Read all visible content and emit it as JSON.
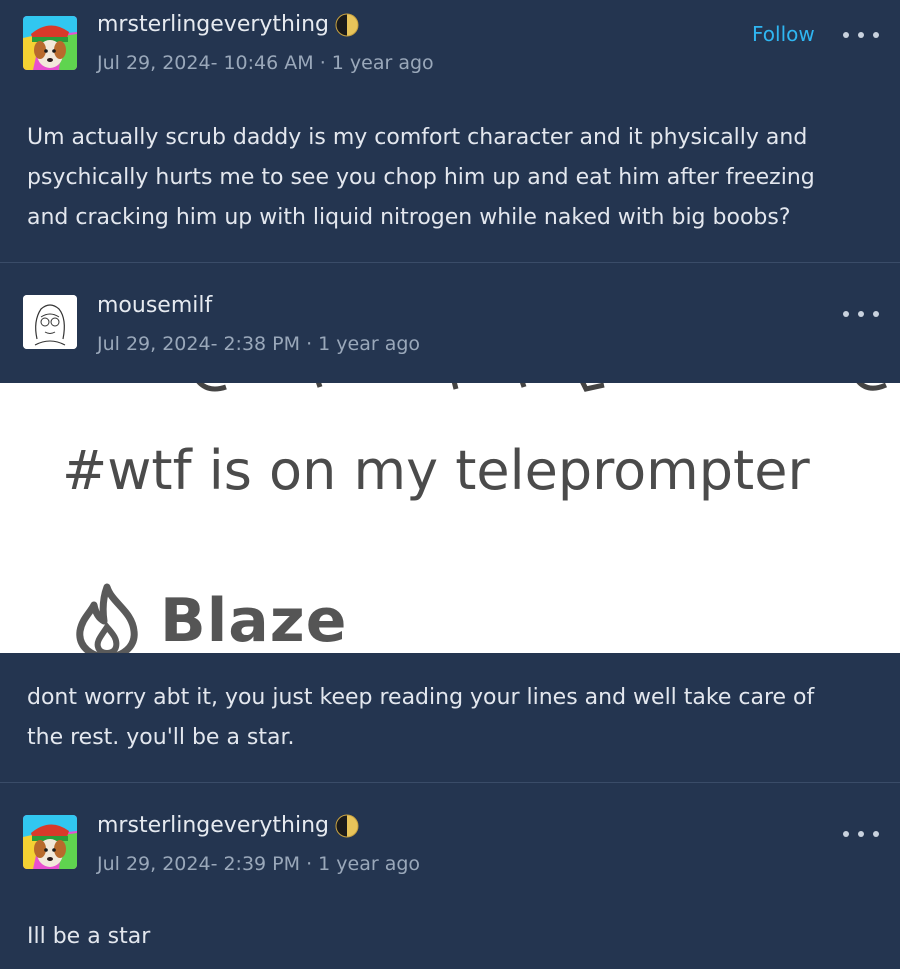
{
  "posts": [
    {
      "username": "mrsterlingeverything",
      "date": "Jul 29, 2024- 10:46 AM",
      "relative": "1 year ago",
      "follow_label": "Follow",
      "text": "Um actually scrub daddy is my comfort character and it physically and psychically hurts me to see you chop him up and eat him after freezing and cracking him up with liquid nitrogen while naked with big boobs?"
    },
    {
      "username": "mousemilf",
      "date": "Jul 29, 2024- 2:38 PM",
      "relative": "1 year ago",
      "image": {
        "caption": "#wtf is on my teleprompter",
        "brand": "Blaze"
      },
      "text": "dont worry abt it, you just keep reading your lines and well take care of the rest. you'll be a star."
    },
    {
      "username": "mrsterlingeverything",
      "date": "Jul 29, 2024- 2:39 PM",
      "relative": "1 year ago",
      "text": "Ill be a star"
    }
  ],
  "separator": "·",
  "colors": {
    "background": "#243550",
    "accent": "#2fb6f2",
    "meta_text": "#9aa8ba"
  },
  "icons": [
    "colorful-dog-avatar-icon",
    "sketch-avatar-icon",
    "half-moon-badge-icon",
    "more-options-icon",
    "flame-icon"
  ]
}
